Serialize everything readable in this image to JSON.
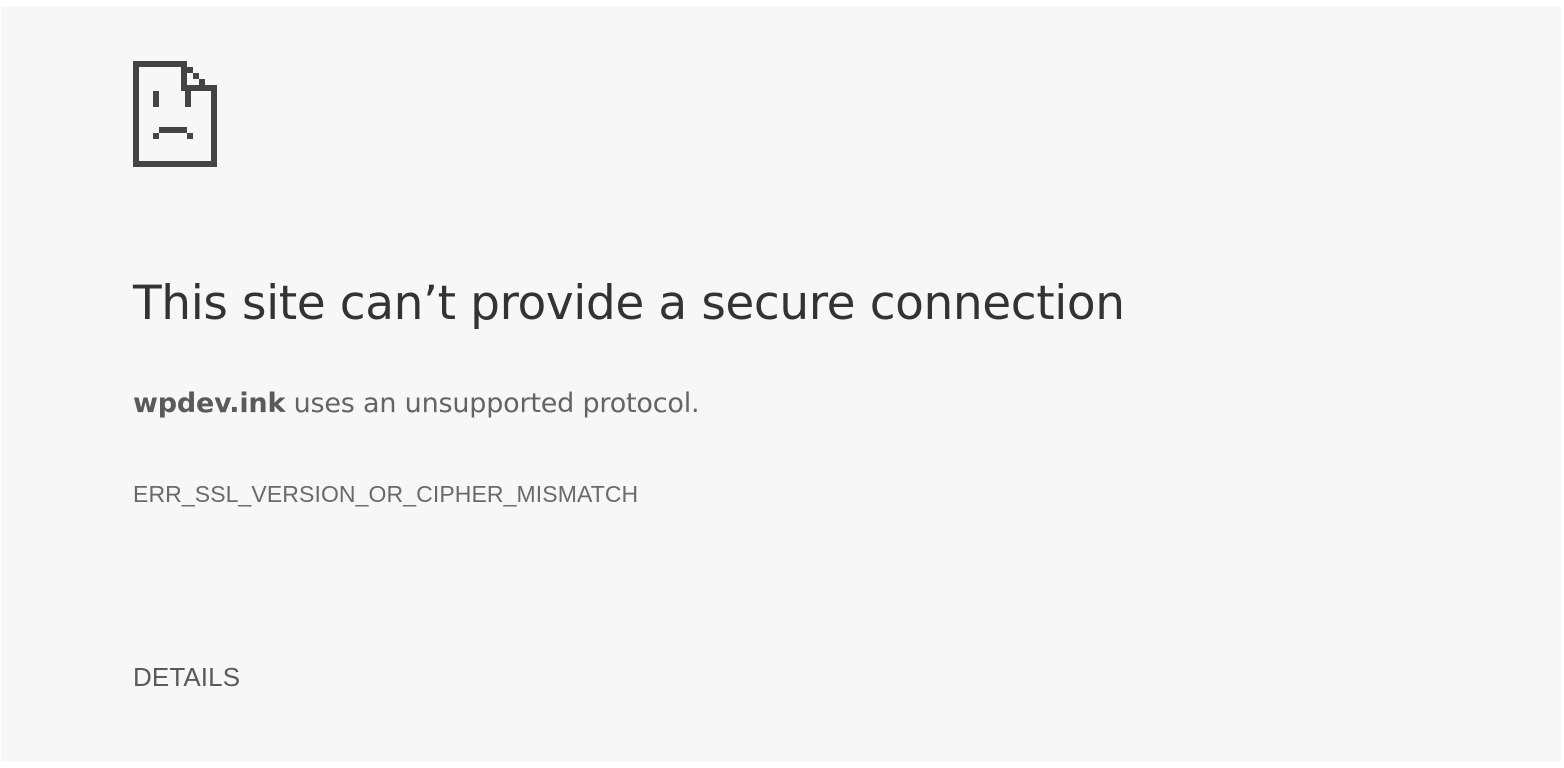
{
  "error_icon": {
    "name": "sad-page-icon",
    "color": "#444444"
  },
  "heading": "This site can’t provide a secure connection",
  "summary": {
    "host": "wpdev.ink",
    "message": " uses an unsupported protocol."
  },
  "error_code": "ERR_SSL_VERSION_OR_CIPHER_MISMATCH",
  "details_button_label": "DETAILS",
  "colors": {
    "background": "#f7f7f7",
    "heading": "#333333",
    "body_text": "#646464"
  }
}
